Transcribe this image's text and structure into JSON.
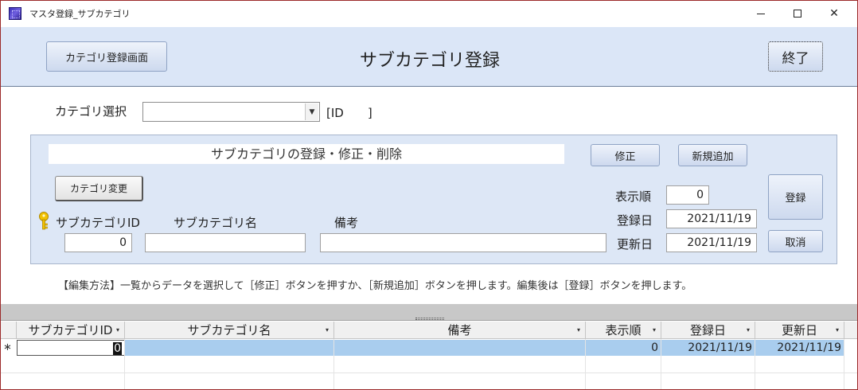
{
  "window": {
    "title": "マスタ登録_サブカテゴリ",
    "minimize_glyph": "",
    "close_glyph": "✕"
  },
  "header": {
    "category_screen_button": "カテゴリ登録画面",
    "title": "サブカテゴリ登録",
    "exit_button": "終了"
  },
  "category_select": {
    "label": "カテゴリ選択",
    "value": "",
    "id_label": "[ID　　]"
  },
  "edit_panel": {
    "caption": "サブカテゴリの登録・修正・削除",
    "modify_button": "修正",
    "add_new_button": "新規追加",
    "change_category_button": "カテゴリ変更",
    "register_button": "登録",
    "cancel_button": "取消",
    "subcategory_id_label": "サブカテゴリID",
    "subcategory_id_value": "0",
    "subcategory_name_label": "サブカテゴリ名",
    "subcategory_name_value": "",
    "note_label": "備考",
    "note_value": "",
    "display_order_label": "表示順",
    "display_order_value": "0",
    "registered_date_label": "登録日",
    "registered_date_value": "2021/11/19",
    "updated_date_label": "更新日",
    "updated_date_value": "2021/11/19"
  },
  "instructions": "【編集方法】一覧からデータを選択して［修正］ボタンを押すか、［新規追加］ボタンを押します。編集後は［登録］ボタンを押します。",
  "grid": {
    "columns": [
      "サブカテゴリID",
      "サブカテゴリ名",
      "備考",
      "表示順",
      "登録日",
      "更新日"
    ],
    "new_row_marker": "∗",
    "rows": [
      [
        "0",
        "",
        "",
        "0",
        "2021/11/19",
        "2021/11/19"
      ]
    ]
  },
  "colors": {
    "header_bg": "#dbe6f7",
    "panel_bg": "#dde7f6",
    "selected_row": "#a9cdee",
    "window_border": "#9c2a2a"
  }
}
